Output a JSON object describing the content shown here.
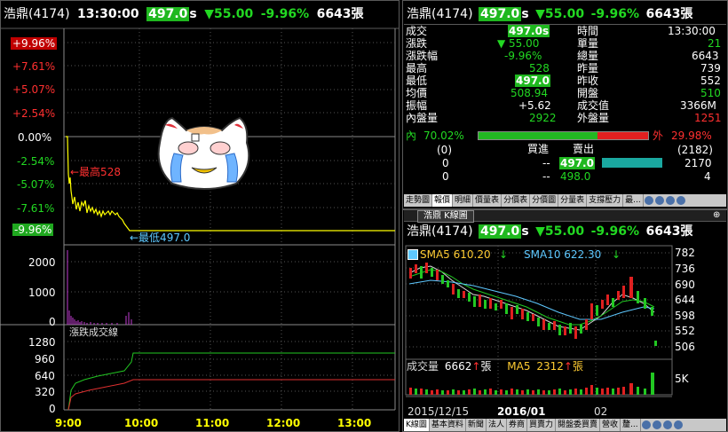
{
  "left_header": {
    "name": "浩鼎(4174)",
    "time": "13:30:00",
    "price": "497.0",
    "price_suffix": "s",
    "change": "▼55.00",
    "change_pct": "-9.96%",
    "volume": "6643張"
  },
  "left_chart": {
    "y_ticks_up": [
      "+9.96%",
      "+7.61%",
      "+5.07%",
      "+2.54%"
    ],
    "y_tick_zero": "0.00%",
    "y_ticks_down": [
      "-2.54%",
      "-5.07%",
      "-7.61%"
    ],
    "y_tick_limit": "-9.96%",
    "high_annot": "←最高528",
    "low_annot": "←最低497.0",
    "vol_ticks": [
      "2000",
      "1000",
      "0"
    ],
    "cum_label": "漲跌成交線",
    "cum_ticks": [
      "1280",
      "960",
      "640",
      "320",
      "0"
    ],
    "x_ticks": [
      "9:00",
      "10:00",
      "11:00",
      "12:00",
      "13:00"
    ]
  },
  "quote": {
    "header": {
      "name": "浩鼎(4174)",
      "price": "497.0",
      "price_suffix": "s",
      "change": "▼55.00",
      "change_pct": "-9.96%",
      "volume": "6643張"
    },
    "left_rows": [
      {
        "label": "成交",
        "value": "497.0s"
      },
      {
        "label": "漲跌",
        "value": "▼ 55.00"
      },
      {
        "label": "漲跌幅",
        "value": "-9.96%"
      },
      {
        "label": "最高",
        "value": "528"
      },
      {
        "label": "最低",
        "value": "497.0"
      },
      {
        "label": "均價",
        "value": "508.94"
      },
      {
        "label": "振幅",
        "value": "+5.62"
      },
      {
        "label": "內盤量",
        "value": "2922"
      }
    ],
    "right_rows": [
      {
        "label": "時間",
        "value": "13:30:00"
      },
      {
        "label": "單量",
        "value": "21"
      },
      {
        "label": "總量",
        "value": "6643"
      },
      {
        "label": "昨量",
        "value": "739"
      },
      {
        "label": "昨收",
        "value": "552"
      },
      {
        "label": "開盤",
        "value": "510"
      },
      {
        "label": "成交值",
        "value": "3366M"
      },
      {
        "label": "外盤量",
        "value": "1251"
      }
    ],
    "inner_label": "內",
    "inner_pct": "70.02%",
    "inner_ratio": 0.7002,
    "outer_label": "外",
    "outer_pct": "29.98%",
    "book_bid_hdr": "買進",
    "book_ask_hdr": "賣出",
    "book_row0": {
      "l": "(0)",
      "r": "(2182)"
    },
    "book_row1": {
      "l": "0",
      "bid": "--",
      "ask": "497.0",
      "r": "2170"
    },
    "book_row2": {
      "l": "0",
      "bid": "--",
      "ask": "498.0",
      "r": "4"
    },
    "tabs": [
      "走勢圖",
      "報價",
      "明細",
      "價量表",
      "分價表",
      "分價圖",
      "分量表",
      "支撐壓力",
      "最..."
    ]
  },
  "kline": {
    "title_tab": "浩鼎 K線圖",
    "header": {
      "name": "浩鼎(4174)",
      "price": "497.0",
      "price_suffix": "s",
      "change": "▼55.00",
      "change_pct": "-9.96%",
      "volume": "6643張"
    },
    "sma5": "SMA5 610.20",
    "sma10": "SMA10 622.30",
    "price_ticks": [
      "782",
      "736",
      "690",
      "644",
      "598",
      "552",
      "506"
    ],
    "vol_label": "成交量",
    "vol_value": "6662",
    "vol_unit": "張",
    "ma5_label": "MA5",
    "ma5_value": "2312",
    "ma5_unit": "張",
    "vol_tick": "5K",
    "dates": [
      "2015/12/15",
      "2016/01",
      "02"
    ],
    "tabs": [
      "K線圖",
      "基本資料",
      "新聞",
      "法人",
      "券商",
      "買賣力",
      "閱盤委買賣",
      "營收",
      "釐..."
    ]
  },
  "sticker": {
    "alt": "crying cat sticker"
  },
  "colors": {
    "up": "#ff3030",
    "down": "#22d822",
    "accent": "#1fb81f",
    "price_line": "#ffff00"
  }
}
